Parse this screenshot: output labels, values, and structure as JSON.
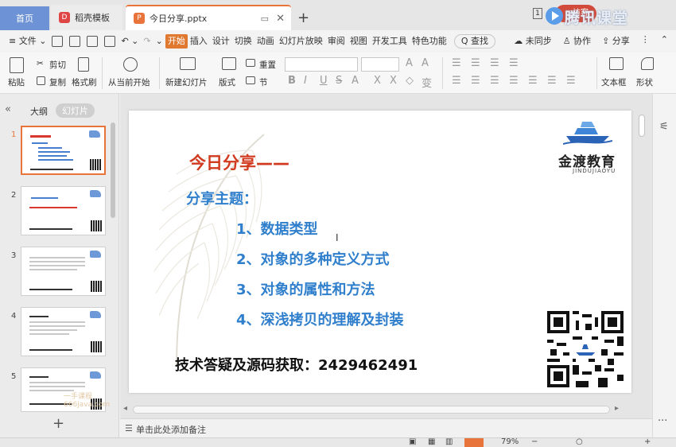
{
  "tabs": {
    "home": "首页",
    "template": "稻壳模板",
    "file": "今日分享.pptx",
    "template_icon": "D",
    "file_icon": "P"
  },
  "window": {
    "badge": "1",
    "visitor": "访客",
    "watermark": "腾讯课堂"
  },
  "menu": {
    "file": "≡ 文件 ⌄",
    "items": [
      "开始",
      "插入",
      "设计",
      "切换",
      "动画",
      "幻灯片放映",
      "审阅",
      "视图",
      "开发工具",
      "特色功能"
    ],
    "search": "Q 查找",
    "unsynced": "☁ 未同步",
    "collab": "♙ 协作",
    "share": "⇪ 分享",
    "more": "⋮",
    "collapse": "⌃"
  },
  "ribbon": {
    "paste": "粘贴",
    "cut": "剪切",
    "copy": "复制",
    "format_painter": "格式刷",
    "from_current": "从当前开始",
    "new_slide": "新建幻灯片",
    "layout": "版式",
    "reset": "重置",
    "section": "节",
    "textbox": "文本框",
    "shape": "形状"
  },
  "left_panel": {
    "outline_tab": "大纲",
    "slides_tab": "幻灯片",
    "collapse": "«",
    "add": "+",
    "watermark": "一手课程  666java.com",
    "thumbnails": [
      {
        "num": "1"
      },
      {
        "num": "2"
      },
      {
        "num": "3"
      },
      {
        "num": "4"
      },
      {
        "num": "5"
      }
    ]
  },
  "slide": {
    "title": "今日分享——",
    "subtitle": "分享主题：",
    "items": [
      "1、数据类型",
      "2、对象的多种定义方式",
      "3、对象的属性和方法",
      "4、深浅拷贝的理解及封装"
    ],
    "bottom": "技术答疑及源码获取：2429462491",
    "logo_text": "金渡教育",
    "logo_sub": "JINDUJIAOYU",
    "cursor": "I"
  },
  "notes": {
    "placeholder": "单击此处添加备注"
  },
  "status": {
    "zoom": "79%"
  },
  "colors": {
    "accent": "#e8743b",
    "title_red": "#d23a1f",
    "topic_blue": "#2f7fcc"
  }
}
